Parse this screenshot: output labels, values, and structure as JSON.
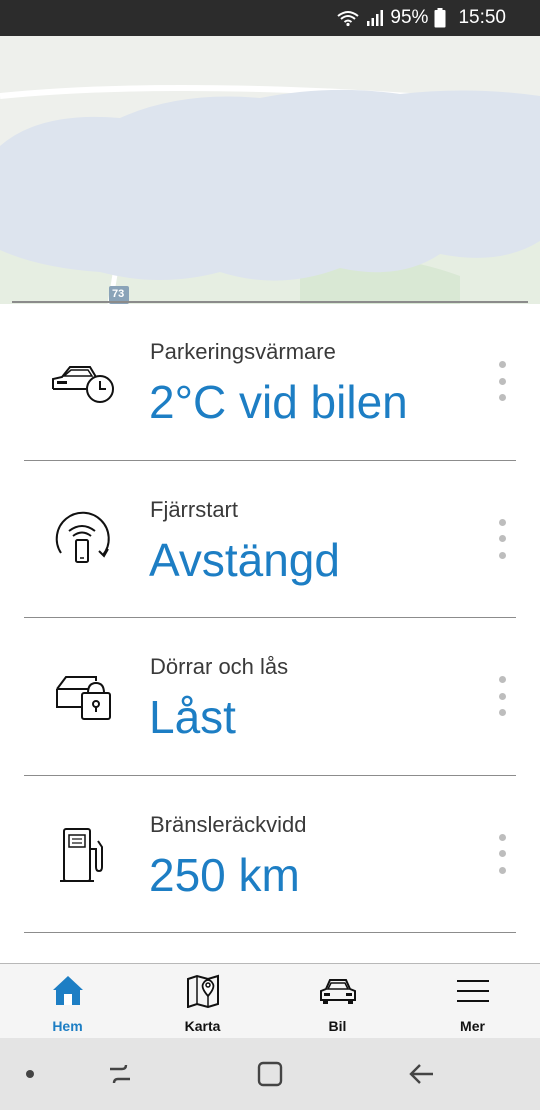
{
  "status_bar": {
    "battery": "95%",
    "time": "15:50",
    "icons": [
      "wifi-icon",
      "signal-icon",
      "battery-icon"
    ]
  },
  "map": {
    "road_number": "73"
  },
  "cards": [
    {
      "label": "Parkeringsvärmare",
      "value": "2°C vid bilen",
      "icon": "car-timer-icon"
    },
    {
      "label": "Fjärrstart",
      "value": "Avstängd",
      "icon": "remote-start-icon"
    },
    {
      "label": "Dörrar och lås",
      "value": "Låst",
      "icon": "car-lock-icon"
    },
    {
      "label": "Bränsleräckvidd",
      "value": "250 km",
      "icon": "fuel-pump-icon"
    }
  ],
  "bottom_nav": [
    {
      "label": "Hem",
      "icon": "home-icon",
      "active": true
    },
    {
      "label": "Karta",
      "icon": "map-icon",
      "active": false
    },
    {
      "label": "Bil",
      "icon": "car-icon",
      "active": false
    },
    {
      "label": "Mer",
      "icon": "menu-icon",
      "active": false
    }
  ],
  "colors": {
    "accent": "#1d7ec4",
    "status_bar": "#2c2c2c",
    "divider": "#8c8c8c"
  }
}
